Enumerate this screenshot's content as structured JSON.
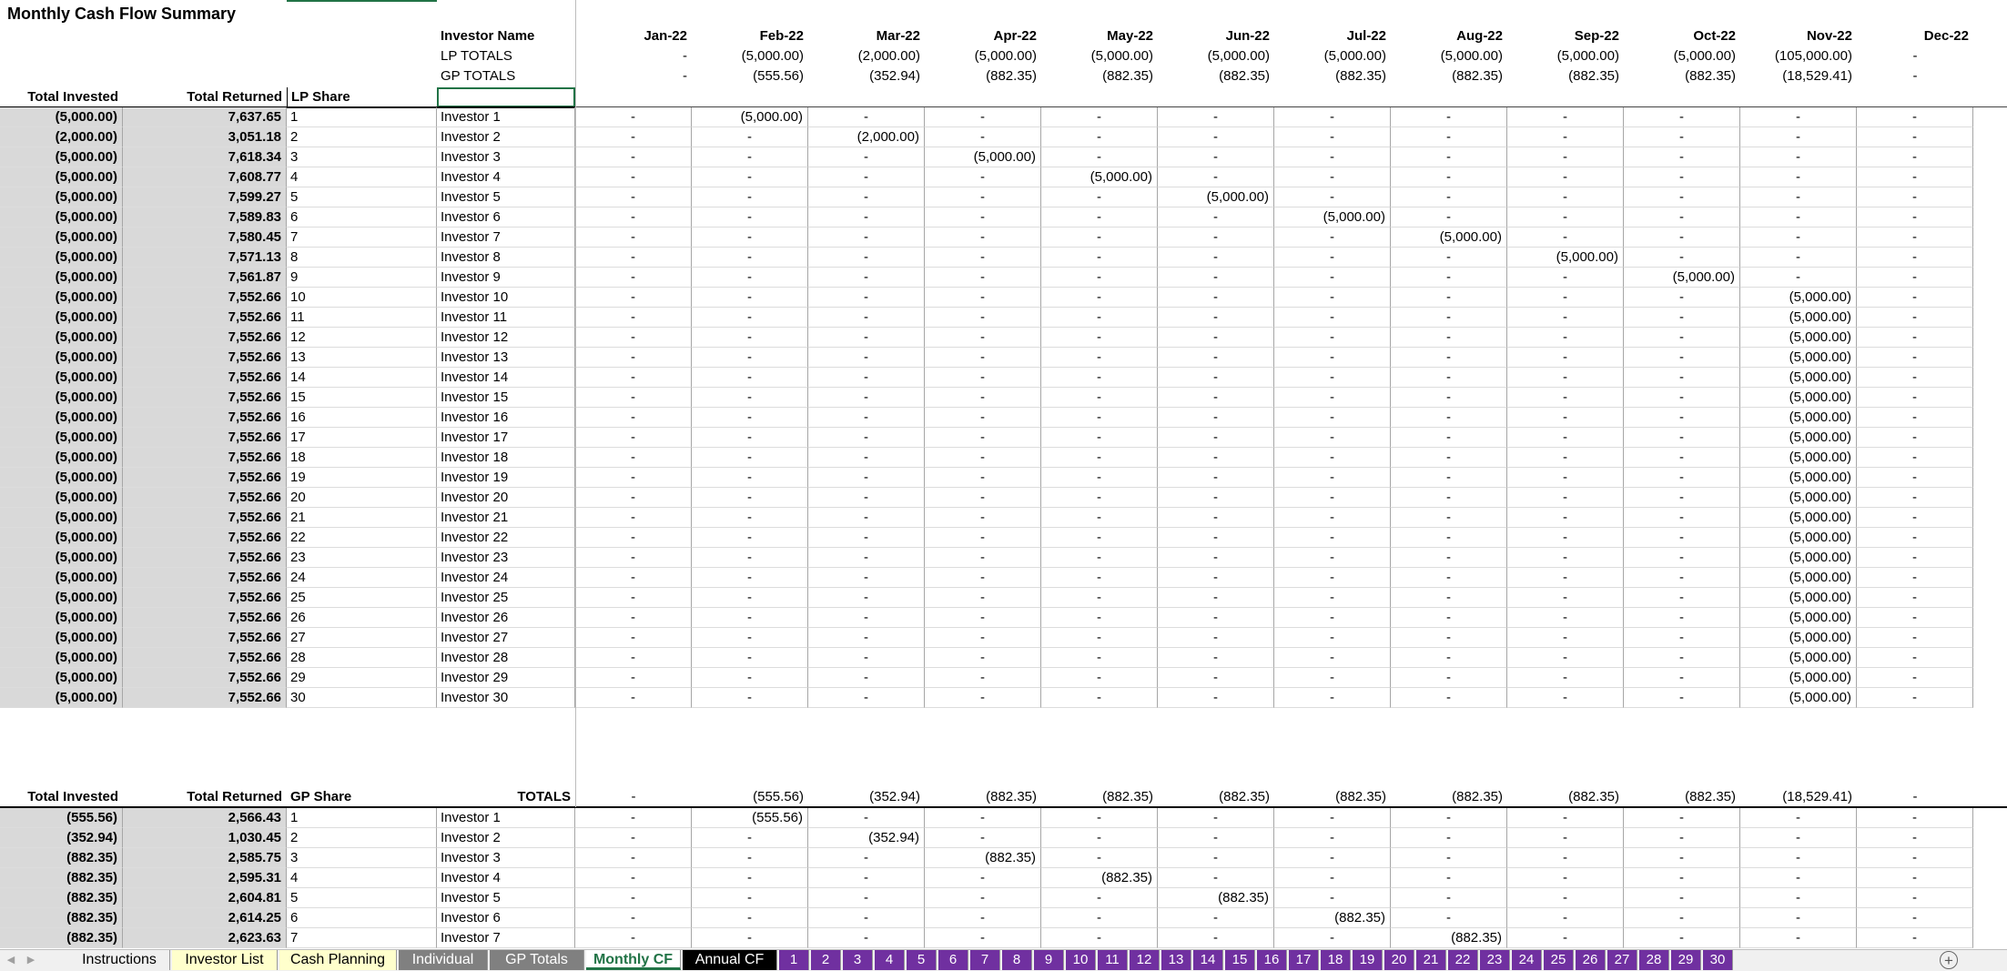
{
  "title": "Monthly Cash Flow Summary",
  "months": [
    "Jan-22",
    "Feb-22",
    "Mar-22",
    "Apr-22",
    "May-22",
    "Jun-22",
    "Jul-22",
    "Aug-22",
    "Sep-22",
    "Oct-22",
    "Nov-22",
    "Dec-22"
  ],
  "header": {
    "investor_name_label": "Investor Name",
    "lp_totals_label": "LP TOTALS",
    "gp_totals_label": "GP TOTALS",
    "lp_totals": [
      "-",
      "(5,000.00)",
      "(2,000.00)",
      "(5,000.00)",
      "(5,000.00)",
      "(5,000.00)",
      "(5,000.00)",
      "(5,000.00)",
      "(5,000.00)",
      "(5,000.00)",
      "(105,000.00)",
      "-"
    ],
    "gp_totals": [
      "-",
      "(555.56)",
      "(352.94)",
      "(882.35)",
      "(882.35)",
      "(882.35)",
      "(882.35)",
      "(882.35)",
      "(882.35)",
      "(882.35)",
      "(18,529.41)",
      "-"
    ]
  },
  "lp_section": {
    "col_total_invested": "Total Invested",
    "col_total_returned": "Total Returned",
    "col_share": "LP Share",
    "rows": [
      {
        "invested": "(5,000.00)",
        "returned": "7,637.65",
        "share": "1",
        "name": "Investor 1",
        "month_col": 1,
        "amount": "(5,000.00)"
      },
      {
        "invested": "(2,000.00)",
        "returned": "3,051.18",
        "share": "2",
        "name": "Investor 2",
        "month_col": 2,
        "amount": "(2,000.00)"
      },
      {
        "invested": "(5,000.00)",
        "returned": "7,618.34",
        "share": "3",
        "name": "Investor 3",
        "month_col": 3,
        "amount": "(5,000.00)"
      },
      {
        "invested": "(5,000.00)",
        "returned": "7,608.77",
        "share": "4",
        "name": "Investor 4",
        "month_col": 4,
        "amount": "(5,000.00)"
      },
      {
        "invested": "(5,000.00)",
        "returned": "7,599.27",
        "share": "5",
        "name": "Investor 5",
        "month_col": 5,
        "amount": "(5,000.00)"
      },
      {
        "invested": "(5,000.00)",
        "returned": "7,589.83",
        "share": "6",
        "name": "Investor 6",
        "month_col": 6,
        "amount": "(5,000.00)"
      },
      {
        "invested": "(5,000.00)",
        "returned": "7,580.45",
        "share": "7",
        "name": "Investor 7",
        "month_col": 7,
        "amount": "(5,000.00)"
      },
      {
        "invested": "(5,000.00)",
        "returned": "7,571.13",
        "share": "8",
        "name": "Investor 8",
        "month_col": 8,
        "amount": "(5,000.00)"
      },
      {
        "invested": "(5,000.00)",
        "returned": "7,561.87",
        "share": "9",
        "name": "Investor 9",
        "month_col": 9,
        "amount": "(5,000.00)"
      },
      {
        "invested": "(5,000.00)",
        "returned": "7,552.66",
        "share": "10",
        "name": "Investor 10",
        "month_col": 10,
        "amount": "(5,000.00)"
      },
      {
        "invested": "(5,000.00)",
        "returned": "7,552.66",
        "share": "11",
        "name": "Investor 11",
        "month_col": 10,
        "amount": "(5,000.00)"
      },
      {
        "invested": "(5,000.00)",
        "returned": "7,552.66",
        "share": "12",
        "name": "Investor 12",
        "month_col": 10,
        "amount": "(5,000.00)"
      },
      {
        "invested": "(5,000.00)",
        "returned": "7,552.66",
        "share": "13",
        "name": "Investor 13",
        "month_col": 10,
        "amount": "(5,000.00)"
      },
      {
        "invested": "(5,000.00)",
        "returned": "7,552.66",
        "share": "14",
        "name": "Investor 14",
        "month_col": 10,
        "amount": "(5,000.00)"
      },
      {
        "invested": "(5,000.00)",
        "returned": "7,552.66",
        "share": "15",
        "name": "Investor 15",
        "month_col": 10,
        "amount": "(5,000.00)"
      },
      {
        "invested": "(5,000.00)",
        "returned": "7,552.66",
        "share": "16",
        "name": "Investor 16",
        "month_col": 10,
        "amount": "(5,000.00)"
      },
      {
        "invested": "(5,000.00)",
        "returned": "7,552.66",
        "share": "17",
        "name": "Investor 17",
        "month_col": 10,
        "amount": "(5,000.00)"
      },
      {
        "invested": "(5,000.00)",
        "returned": "7,552.66",
        "share": "18",
        "name": "Investor 18",
        "month_col": 10,
        "amount": "(5,000.00)"
      },
      {
        "invested": "(5,000.00)",
        "returned": "7,552.66",
        "share": "19",
        "name": "Investor 19",
        "month_col": 10,
        "amount": "(5,000.00)"
      },
      {
        "invested": "(5,000.00)",
        "returned": "7,552.66",
        "share": "20",
        "name": "Investor 20",
        "month_col": 10,
        "amount": "(5,000.00)"
      },
      {
        "invested": "(5,000.00)",
        "returned": "7,552.66",
        "share": "21",
        "name": "Investor 21",
        "month_col": 10,
        "amount": "(5,000.00)"
      },
      {
        "invested": "(5,000.00)",
        "returned": "7,552.66",
        "share": "22",
        "name": "Investor 22",
        "month_col": 10,
        "amount": "(5,000.00)"
      },
      {
        "invested": "(5,000.00)",
        "returned": "7,552.66",
        "share": "23",
        "name": "Investor 23",
        "month_col": 10,
        "amount": "(5,000.00)"
      },
      {
        "invested": "(5,000.00)",
        "returned": "7,552.66",
        "share": "24",
        "name": "Investor 24",
        "month_col": 10,
        "amount": "(5,000.00)"
      },
      {
        "invested": "(5,000.00)",
        "returned": "7,552.66",
        "share": "25",
        "name": "Investor 25",
        "month_col": 10,
        "amount": "(5,000.00)"
      },
      {
        "invested": "(5,000.00)",
        "returned": "7,552.66",
        "share": "26",
        "name": "Investor 26",
        "month_col": 10,
        "amount": "(5,000.00)"
      },
      {
        "invested": "(5,000.00)",
        "returned": "7,552.66",
        "share": "27",
        "name": "Investor 27",
        "month_col": 10,
        "amount": "(5,000.00)"
      },
      {
        "invested": "(5,000.00)",
        "returned": "7,552.66",
        "share": "28",
        "name": "Investor 28",
        "month_col": 10,
        "amount": "(5,000.00)"
      },
      {
        "invested": "(5,000.00)",
        "returned": "7,552.66",
        "share": "29",
        "name": "Investor 29",
        "month_col": 10,
        "amount": "(5,000.00)"
      },
      {
        "invested": "(5,000.00)",
        "returned": "7,552.66",
        "share": "30",
        "name": "Investor 30",
        "month_col": 10,
        "amount": "(5,000.00)"
      }
    ]
  },
  "gp_section": {
    "col_total_invested": "Total Invested",
    "col_total_returned": "Total Returned",
    "col_share": "GP Share",
    "totals_label": "TOTALS",
    "totals": [
      "-",
      "(555.56)",
      "(352.94)",
      "(882.35)",
      "(882.35)",
      "(882.35)",
      "(882.35)",
      "(882.35)",
      "(882.35)",
      "(882.35)",
      "(18,529.41)",
      "-"
    ],
    "rows": [
      {
        "invested": "(555.56)",
        "returned": "2,566.43",
        "share": "1",
        "name": "Investor 1",
        "month_col": 1,
        "amount": "(555.56)"
      },
      {
        "invested": "(352.94)",
        "returned": "1,030.45",
        "share": "2",
        "name": "Investor 2",
        "month_col": 2,
        "amount": "(352.94)"
      },
      {
        "invested": "(882.35)",
        "returned": "2,585.75",
        "share": "3",
        "name": "Investor 3",
        "month_col": 3,
        "amount": "(882.35)"
      },
      {
        "invested": "(882.35)",
        "returned": "2,595.31",
        "share": "4",
        "name": "Investor 4",
        "month_col": 4,
        "amount": "(882.35)"
      },
      {
        "invested": "(882.35)",
        "returned": "2,604.81",
        "share": "5",
        "name": "Investor 5",
        "month_col": 5,
        "amount": "(882.35)"
      },
      {
        "invested": "(882.35)",
        "returned": "2,614.25",
        "share": "6",
        "name": "Investor 6",
        "month_col": 6,
        "amount": "(882.35)"
      },
      {
        "invested": "(882.35)",
        "returned": "2,623.63",
        "share": "7",
        "name": "Investor 7",
        "month_col": 7,
        "amount": "(882.35)"
      }
    ]
  },
  "empty_cell": "-",
  "tabs": [
    {
      "label": "Instructions",
      "style": "plain"
    },
    {
      "label": "Investor List",
      "style": "yellow"
    },
    {
      "label": "Cash Planning",
      "style": "yellow"
    },
    {
      "label": "Individual",
      "style": "grey"
    },
    {
      "label": "GP Totals",
      "style": "grey"
    },
    {
      "label": "Monthly CF",
      "style": "active"
    },
    {
      "label": "Annual CF",
      "style": "black"
    },
    {
      "label": "1",
      "style": "num"
    },
    {
      "label": "2",
      "style": "num"
    },
    {
      "label": "3",
      "style": "num"
    },
    {
      "label": "4",
      "style": "num"
    },
    {
      "label": "5",
      "style": "num"
    },
    {
      "label": "6",
      "style": "num"
    },
    {
      "label": "7",
      "style": "num"
    },
    {
      "label": "8",
      "style": "num"
    },
    {
      "label": "9",
      "style": "num"
    },
    {
      "label": "10",
      "style": "num"
    },
    {
      "label": "11",
      "style": "num"
    },
    {
      "label": "12",
      "style": "num"
    },
    {
      "label": "13",
      "style": "num"
    },
    {
      "label": "14",
      "style": "num"
    },
    {
      "label": "15",
      "style": "num"
    },
    {
      "label": "16",
      "style": "num"
    },
    {
      "label": "17",
      "style": "num"
    },
    {
      "label": "18",
      "style": "num"
    },
    {
      "label": "19",
      "style": "num"
    },
    {
      "label": "20",
      "style": "num"
    },
    {
      "label": "21",
      "style": "num"
    },
    {
      "label": "22",
      "style": "num"
    },
    {
      "label": "23",
      "style": "num"
    },
    {
      "label": "24",
      "style": "num"
    },
    {
      "label": "25",
      "style": "num"
    },
    {
      "label": "26",
      "style": "num"
    },
    {
      "label": "27",
      "style": "num"
    },
    {
      "label": "28",
      "style": "num"
    },
    {
      "label": "29",
      "style": "num"
    },
    {
      "label": "30",
      "style": "num"
    }
  ],
  "tab_nav": {
    "prev": "◀",
    "next": "▶",
    "add": "+"
  }
}
